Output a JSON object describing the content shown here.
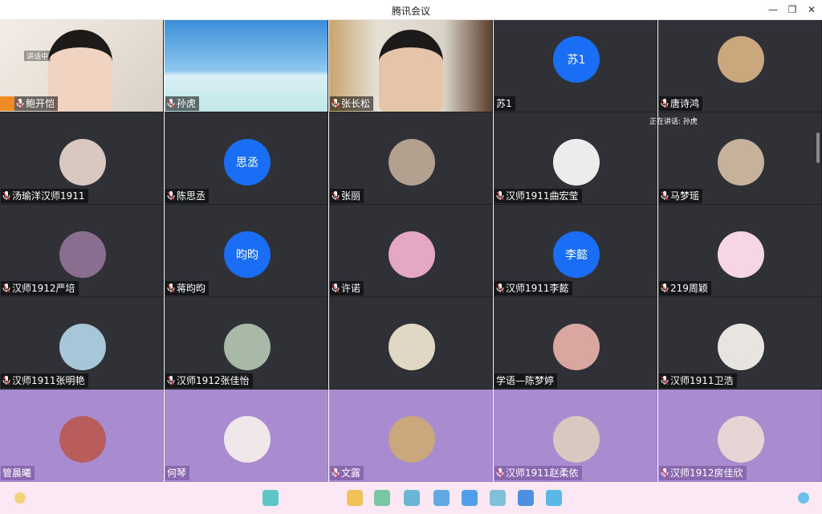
{
  "window": {
    "title": "腾讯会议",
    "minimize_glyph": "—",
    "restore_glyph": "❐",
    "close_glyph": "✕"
  },
  "speaking_tip": "正在讲话: 孙虎",
  "participants": [
    {
      "name": "鲍开恺",
      "kind": "video",
      "note": "讲话中"
    },
    {
      "name": "孙虎",
      "kind": "video"
    },
    {
      "name": "张长松",
      "kind": "video"
    },
    {
      "name": "苏1",
      "kind": "text",
      "avatar_text": "苏1"
    },
    {
      "name": "唐诗鸿",
      "kind": "photo"
    },
    {
      "name": "汤瑜洋汉师1911",
      "kind": "photo"
    },
    {
      "name": "陈思丞",
      "kind": "text",
      "avatar_text": "思丞"
    },
    {
      "name": "张丽",
      "kind": "photo"
    },
    {
      "name": "汉师1911曲宏莹",
      "kind": "photo"
    },
    {
      "name": "马梦瑶",
      "kind": "photo"
    },
    {
      "name": "汉师1912严培",
      "kind": "photo"
    },
    {
      "name": "蒋昀昀",
      "kind": "text",
      "avatar_text": "昀昀"
    },
    {
      "name": "许诺",
      "kind": "photo"
    },
    {
      "name": "汉师1911李懿",
      "kind": "text",
      "avatar_text": "李懿"
    },
    {
      "name": "219周颖",
      "kind": "photo"
    },
    {
      "name": "汉师1911张明艳",
      "kind": "photo"
    },
    {
      "name": "汉师1912张佳怡",
      "kind": "photo"
    },
    {
      "name": "",
      "kind": "photo"
    },
    {
      "name": "学语—陈梦婷",
      "kind": "photo"
    },
    {
      "name": "汉师1911卫浩",
      "kind": "photo"
    },
    {
      "name": "管晨曦",
      "kind": "photo"
    },
    {
      "name": "何琴",
      "kind": "photo"
    },
    {
      "name": "文露",
      "kind": "photo"
    },
    {
      "name": "汉师1911赵柔依",
      "kind": "photo"
    },
    {
      "name": "汉师1912房佳欣",
      "kind": "photo"
    }
  ],
  "colors": {
    "tile_bg": "#2f3136",
    "purple_bg": "#a98bcf",
    "avatar_blue": "#1a6ef5",
    "toolbar_bg": "#fbe8f4"
  }
}
